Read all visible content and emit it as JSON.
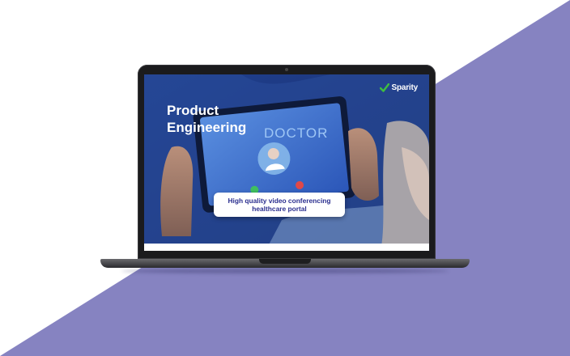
{
  "colors": {
    "background": "#ffffff",
    "accent_band": "#8683c1",
    "laptop_frame": "#1b1b1d",
    "caption_text": "#2b2f8f",
    "logo_check": "#3fbf3f"
  },
  "screen": {
    "title_line1": "Product",
    "title_line2": "Engineering",
    "logo_text": "Sparity",
    "logo_icon": "check-icon",
    "tablet_text": "DOCTOR",
    "caption_line1": "High quality video conferencing",
    "caption_line2": "healthcare portal"
  }
}
